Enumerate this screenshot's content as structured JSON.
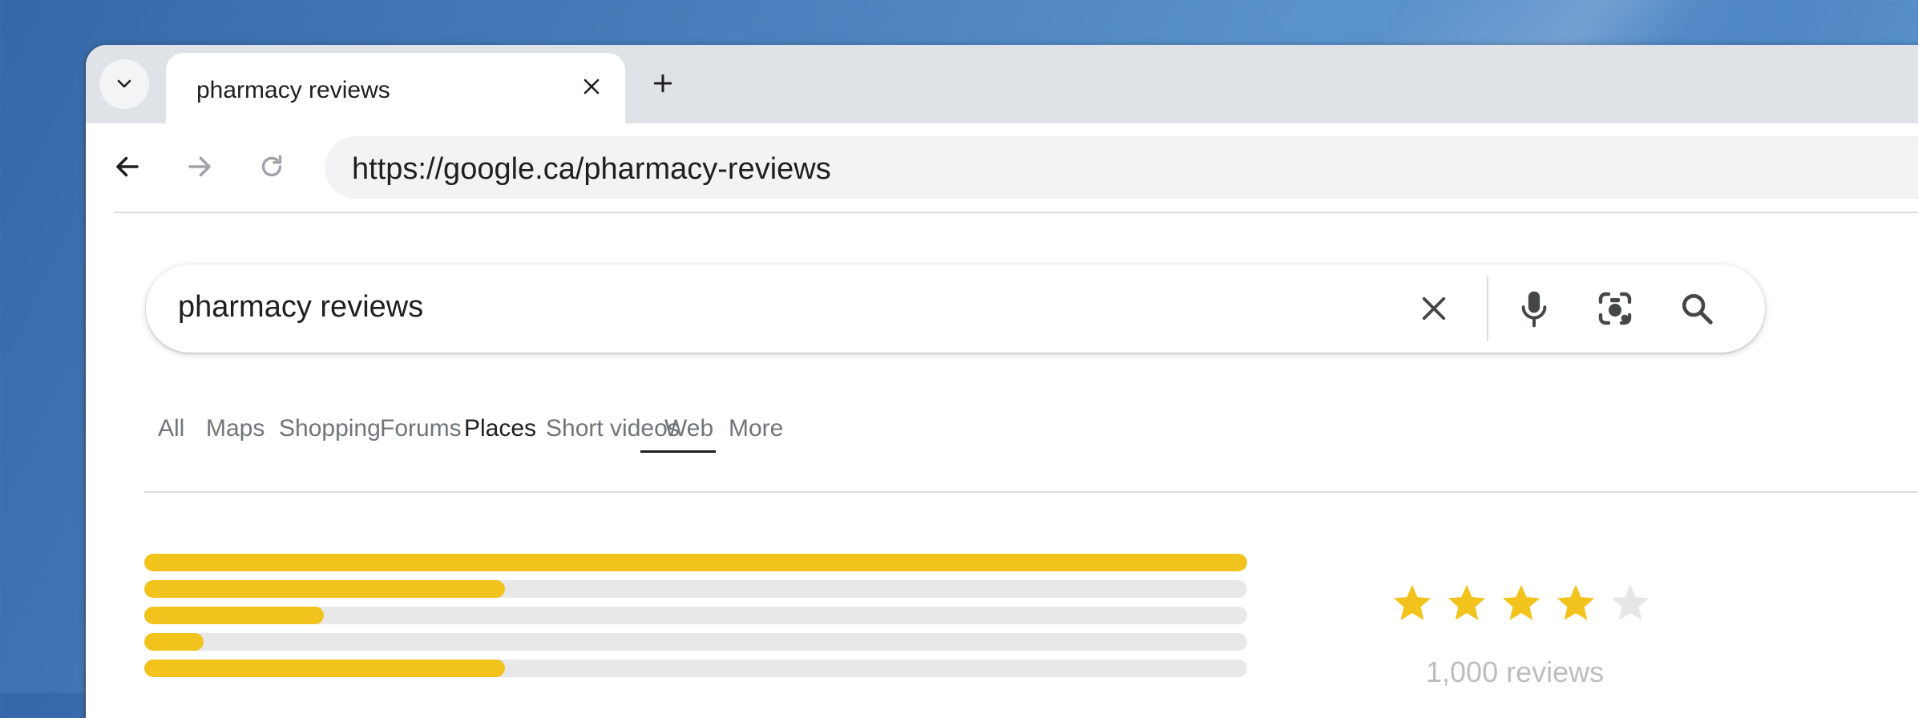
{
  "browser": {
    "tab_title": "pharmacy reviews",
    "url": "https://google.ca/pharmacy-reviews"
  },
  "search": {
    "query": "pharmacy reviews"
  },
  "search_tabs": [
    {
      "label": "All"
    },
    {
      "label": "Maps"
    },
    {
      "label": "Shopping"
    },
    {
      "label": "Forums"
    },
    {
      "label": "Places"
    },
    {
      "label": "Short videos"
    },
    {
      "label": "Web"
    },
    {
      "label": "More"
    }
  ],
  "active_tab": "Places",
  "rating": {
    "distribution_fill_fractions": [
      1.0,
      0.327,
      0.163,
      0.054,
      0.327
    ],
    "stars_filled": 4,
    "stars_total": 5,
    "review_count_text": "1,000 reviews"
  },
  "colors": {
    "star_filled": "#f2c21d",
    "star_empty": "#e6e6e6",
    "bar_fill": "#f2c21d",
    "bar_track": "#e8e8e8"
  },
  "icons": {
    "tab_menu": "chevron-down-icon",
    "tab_close": "close-icon",
    "new_tab": "plus-icon",
    "back": "arrow-back-icon",
    "forward": "arrow-forward-icon",
    "reload": "reload-icon",
    "clear": "close-icon",
    "voice": "microphone-icon",
    "lens": "camera-lens-icon",
    "search": "search-icon"
  }
}
